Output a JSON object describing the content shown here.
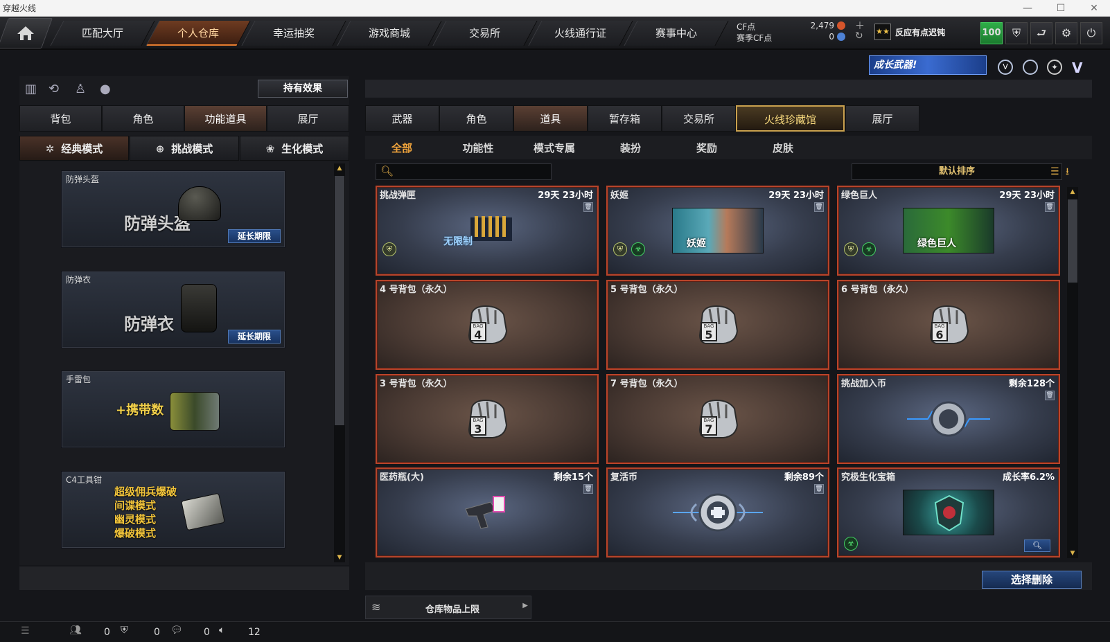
{
  "window": {
    "title": "穿越火线"
  },
  "topnav": {
    "tabs": [
      "匹配大厅",
      "个人仓库",
      "幸运抽奖",
      "游戏商城",
      "交易所",
      "火线通行证",
      "赛事中心"
    ],
    "active_index": 1,
    "cf_label": "CF点",
    "cf_value": "2,479",
    "season_label": "赛季CF点",
    "season_value": "0",
    "notice": "反应有点迟钝",
    "level": "100"
  },
  "banner": {
    "text": "成长武器!"
  },
  "left": {
    "effects_button": "持有效果",
    "tabs": [
      "背包",
      "角色",
      "功能道具",
      "展厅"
    ],
    "active_tab": 2,
    "modes": [
      "经典模式",
      "挑战模式",
      "生化模式"
    ],
    "active_mode": 0,
    "cards": [
      {
        "label": "防弹头盔",
        "big": "防弹头盔",
        "button": "延长期限"
      },
      {
        "label": "防弹衣",
        "big": "防弹衣",
        "button": "延长期限"
      },
      {
        "label": "手雷包",
        "big": "+携带数",
        "button": ""
      },
      {
        "label": "C4工具钳",
        "lines": [
          "超级佣兵爆破",
          "间谍模式",
          "幽灵模式",
          "爆破模式"
        ]
      }
    ]
  },
  "right": {
    "tabs": [
      "武器",
      "角色",
      "道具",
      "暂存箱",
      "交易所",
      "火线珍藏馆",
      "展厅"
    ],
    "active_tab": 2,
    "highlight_tab": 5,
    "subtabs": [
      "全部",
      "功能性",
      "模式专属",
      "装扮",
      "奖励",
      "皮肤"
    ],
    "active_subtab": 0,
    "search_placeholder": "",
    "sort_label": "默认排序",
    "items": [
      {
        "name": "挑战弹匣",
        "time": "29天 23小时",
        "pic_text": "无限制"
      },
      {
        "name": "妖姬",
        "time": "29天 23小时",
        "pic_text": "妖姬"
      },
      {
        "name": "绿色巨人",
        "time": "29天 23小时",
        "pic_text": "绿色巨人"
      },
      {
        "name": "4 号背包（永久）",
        "time": "",
        "bag": "4"
      },
      {
        "name": "5 号背包（永久）",
        "time": "",
        "bag": "5"
      },
      {
        "name": "6 号背包（永久）",
        "time": "",
        "bag": "6"
      },
      {
        "name": "3 号背包（永久）",
        "time": "",
        "bag": "3"
      },
      {
        "name": "7 号背包（永久）",
        "time": "",
        "bag": "7"
      },
      {
        "name": "挑战加入币",
        "time": "剩余128个"
      },
      {
        "name": "医药瓶(大)",
        "time": "剩余15个"
      },
      {
        "name": "复活币",
        "time": "剩余89个"
      },
      {
        "name": "究极生化宝箱",
        "time": "成长率6.2%"
      }
    ],
    "delete_button": "选择删除",
    "storage_label": "仓库物品上限"
  },
  "statusbar": {
    "a": "0",
    "b": "0",
    "c": "0",
    "d": "12"
  }
}
